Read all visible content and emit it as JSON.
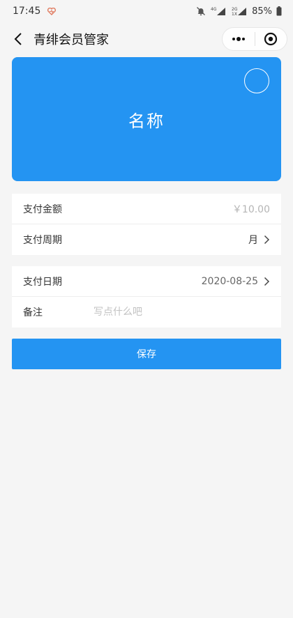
{
  "status_bar": {
    "time": "17:45",
    "battery": "85%",
    "network_1": "4G",
    "network_2": "2G",
    "network_3": "1X"
  },
  "nav": {
    "title": "青绯会员管家"
  },
  "card": {
    "name": "名称",
    "color": "#2494f2"
  },
  "form": {
    "amount": {
      "label": "支付金额",
      "value": "￥10.00"
    },
    "period": {
      "label": "支付周期",
      "value": "月"
    },
    "date": {
      "label": "支付日期",
      "value": "2020-08-25"
    },
    "remark": {
      "label": "备注",
      "placeholder": "写点什么吧"
    }
  },
  "save_label": "保存"
}
